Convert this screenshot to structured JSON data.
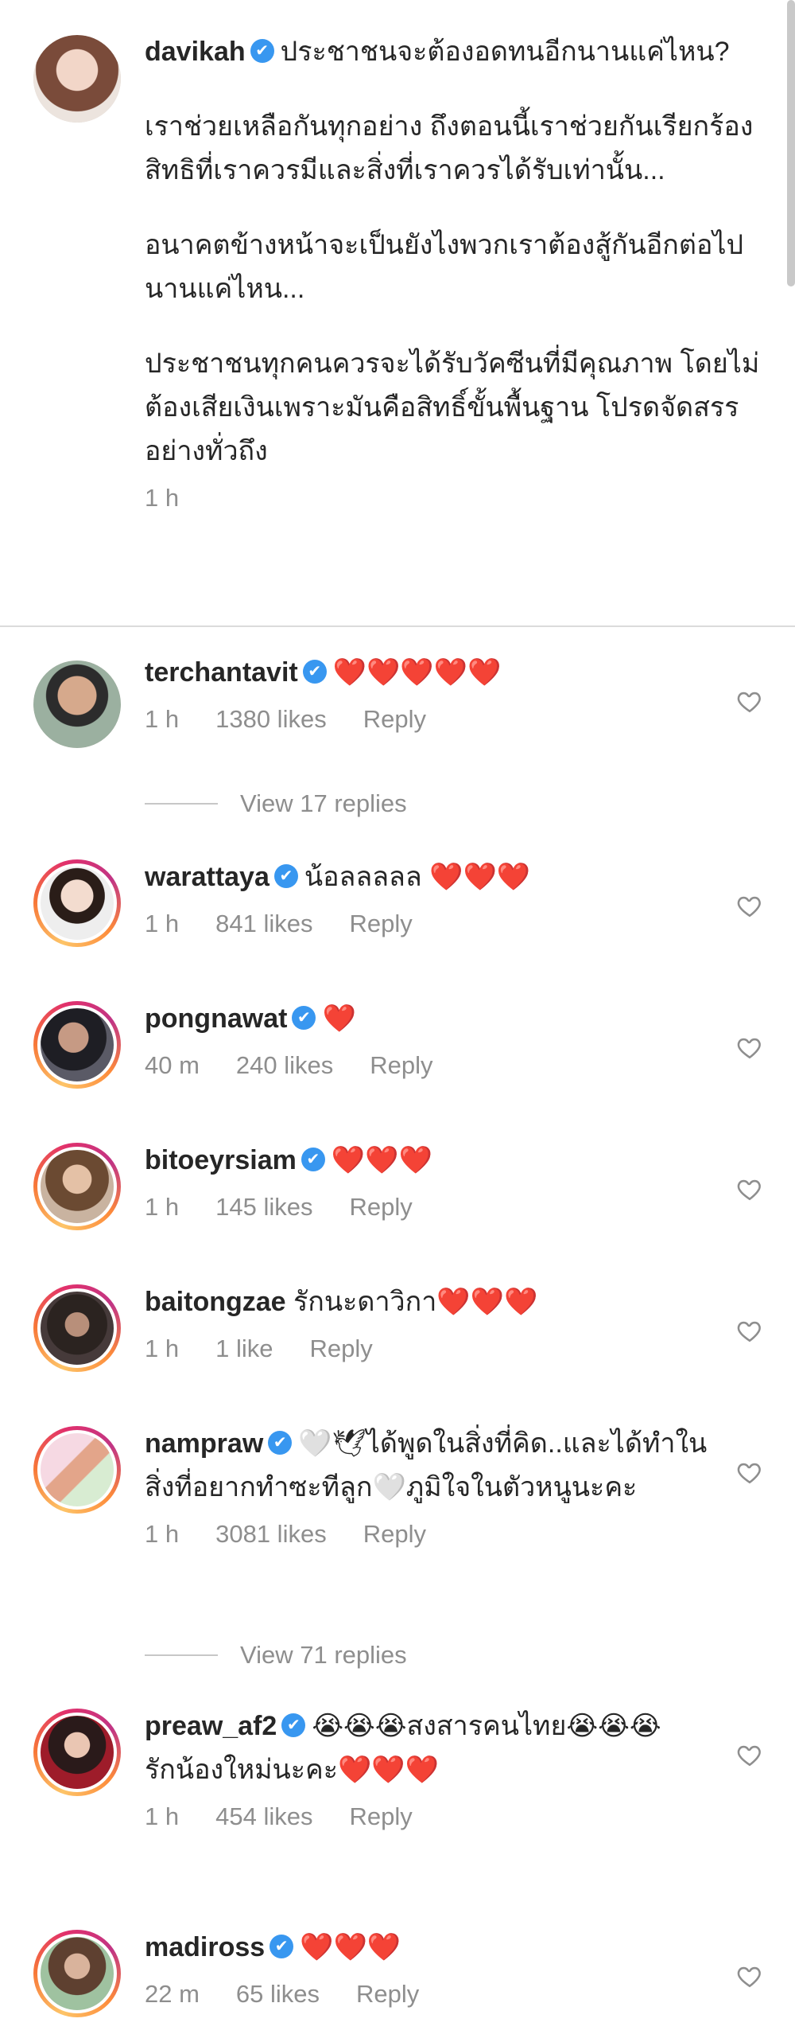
{
  "post": {
    "username": "davikah",
    "paragraphs": [
      "ประชาชนจะต้องอดทนอีกนานแค่ไหน?",
      "เราช่วยเหลือกันทุกอย่าง ถึงตอนนี้เราช่วยกันเรียกร้องสิทธิที่เราควรมีและสิ่งที่เราควรได้รับเท่านั้น...",
      "อนาคตข้างหน้าจะเป็นยังไงพวกเราต้องสู้กันอีกต่อไปนานแค่ไหน...",
      "ประชาชนทุกคนควรจะได้รับวัคซีนที่มีคุณภาพ โดยไม่ต้องเสียเงินเพราะมันคือสิทธิ์ขั้นพื้นฐาน โปรดจัดสรรอย่างทั่วถึง"
    ],
    "time": "1 h"
  },
  "verified_icon": "✔",
  "reply_label": "Reply",
  "comments": [
    {
      "username": "terchantavit",
      "text": "❤️❤️❤️❤️❤️",
      "time": "1 h",
      "likes": "1380 likes"
    },
    {
      "username": "warattaya",
      "text": "น้อลลลลล ❤️❤️❤️",
      "time": "1 h",
      "likes": "841 likes"
    },
    {
      "username": "pongnawat",
      "text": "❤️",
      "time": "40 m",
      "likes": "240 likes"
    },
    {
      "username": "bitoeyrsiam",
      "text": "❤️❤️❤️",
      "time": "1 h",
      "likes": "145 likes"
    },
    {
      "username": "baitongzae",
      "text": "รักนะดาวิกา❤️❤️❤️",
      "time": "1 h",
      "likes": "1 like"
    },
    {
      "username": "nampraw",
      "text": "🤍🕊ได้พูดในสิ่งที่คิด..และได้ทำในสิ่งที่อยากทำซะทีลูก🤍ภูมิใจในตัวหนูนะคะ",
      "time": "1 h",
      "likes": "3081 likes"
    },
    {
      "username": "preaw_af2",
      "text": "😭😭😭สงสารคนไทย😭😭😭",
      "text2": "รักน้องใหม่นะคะ❤️❤️❤️",
      "time": "1 h",
      "likes": "454 likes"
    },
    {
      "username": "madiross",
      "text": "❤️❤️❤️",
      "time": "22 m",
      "likes": "65 likes"
    }
  ],
  "view_replies": [
    "View 17 replies",
    "View 71 replies"
  ],
  "icons": {
    "like": "heart-outline-icon",
    "verified": "verified-badge-icon"
  }
}
